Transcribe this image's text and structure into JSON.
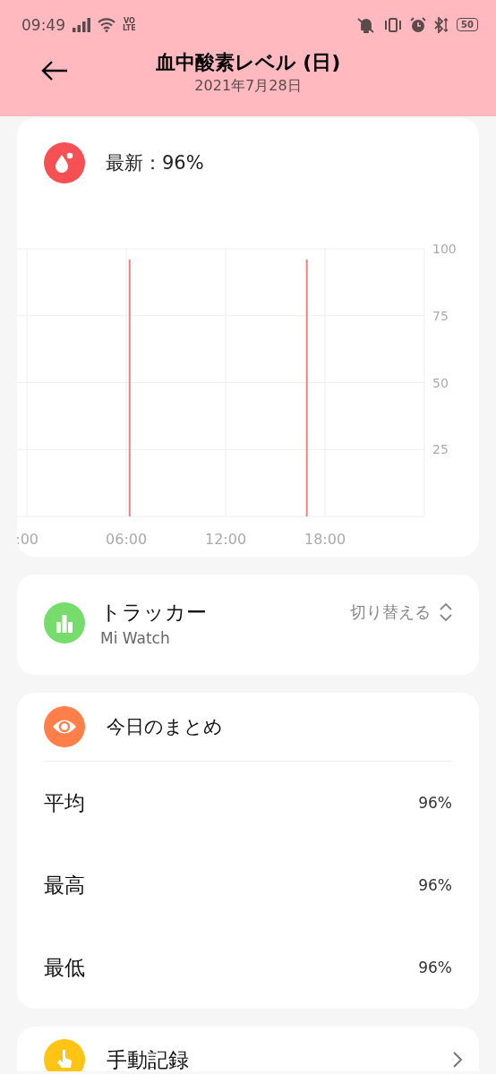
{
  "status_bar": {
    "time": "09:49",
    "network_label": "VO\nLTE",
    "battery": "50"
  },
  "header": {
    "title": "血中酸素レベル (日)",
    "date": "2021年7月28日"
  },
  "latest_card": {
    "label": "最新：96%",
    "chart_data": {
      "type": "bar",
      "x": [
        6.2,
        16.9
      ],
      "series": [
        {
          "color": "#f47f7f",
          "values": [
            96,
            96
          ]
        }
      ],
      "grid": true,
      "xlim": [
        -0.6,
        24
      ],
      "ylim": [
        0,
        100
      ],
      "xticks": [
        {
          "value": 0,
          "label": ":00"
        },
        {
          "value": 6,
          "label": "06:00"
        },
        {
          "value": 12,
          "label": "12:00"
        },
        {
          "value": 18,
          "label": "18:00"
        }
      ],
      "yticks": [
        25,
        50,
        75,
        100
      ]
    }
  },
  "tracker_card": {
    "title": "トラッカー",
    "device": "Mi Watch",
    "switch_label": "切り替える"
  },
  "summary_card": {
    "title": "今日のまとめ",
    "rows": [
      {
        "label": "平均",
        "value": "96%"
      },
      {
        "label": "最高",
        "value": "96%"
      },
      {
        "label": "最低",
        "value": "96%"
      }
    ]
  },
  "manual_card": {
    "title": "手動記録"
  }
}
